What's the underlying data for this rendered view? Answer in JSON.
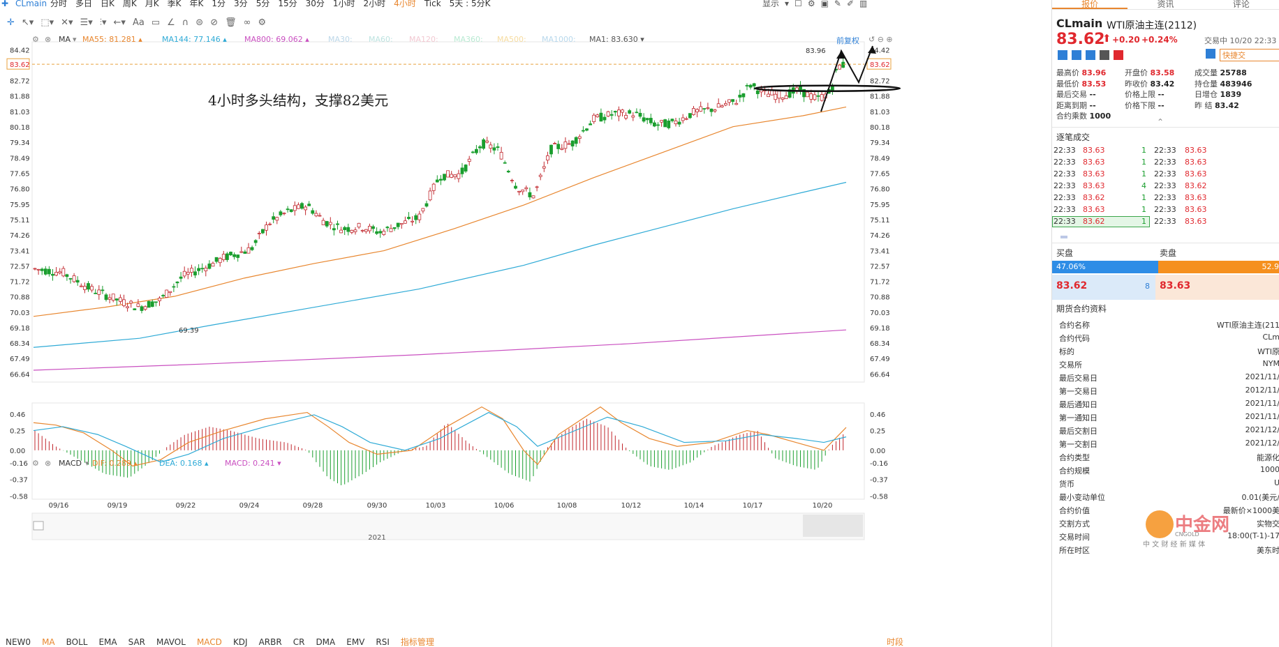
{
  "topbar": {
    "symbol": "CLmain",
    "timeframes": [
      "分时",
      "多日",
      "日K",
      "周K",
      "月K",
      "季K",
      "年K",
      "1分",
      "3分",
      "5分",
      "15分",
      "30分",
      "1小时",
      "2小时",
      "4小时",
      "Tick",
      "5天 : 5分K"
    ],
    "selected": "4小时",
    "right_label": "显示"
  },
  "ma_legend": {
    "label": "MA",
    "items": [
      {
        "text": "MA55: 81.281",
        "color": "#e8862e"
      },
      {
        "text": "MA144: 77.146",
        "color": "#2eaad6"
      },
      {
        "text": "MA800: 69.062",
        "color": "#c94fc0"
      },
      {
        "text": "MA30:",
        "color": "#bcd7e8"
      },
      {
        "text": "MA60:",
        "color": "#bde3e0"
      },
      {
        "text": "MA120:",
        "color": "#f2c9d2"
      },
      {
        "text": "MA360:",
        "color": "#b8ead2"
      },
      {
        "text": "MA500:",
        "color": "#f6dca0"
      },
      {
        "text": "MA1000:",
        "color": "#b8d8ec"
      },
      {
        "text": "MA1: 83.630",
        "color": "#555555"
      }
    ],
    "restore": "前复权"
  },
  "macd_legend": {
    "label": "MACD",
    "items": [
      {
        "text": "DIF: 0.289",
        "color": "#e8862e"
      },
      {
        "text": "DEA: 0.168",
        "color": "#2eaad6"
      },
      {
        "text": "MACD: 0.241",
        "color": "#c94fc0"
      }
    ]
  },
  "annotation": "4小时多头结构，支撑82美元",
  "price_axis": [
    "84.42",
    "83.62",
    "82.72",
    "81.88",
    "81.03",
    "80.18",
    "79.34",
    "78.49",
    "77.65",
    "76.80",
    "75.95",
    "75.11",
    "74.26",
    "73.41",
    "72.57",
    "71.72",
    "70.88",
    "70.03",
    "69.18",
    "68.34",
    "67.49",
    "66.64"
  ],
  "current_price": "83.62",
  "high_label": "83.96",
  "low_label": "69.39",
  "macd_axis": [
    "0.46",
    "0.25",
    "0.00",
    "-0.16",
    "-0.37",
    "-0.58"
  ],
  "date_axis": [
    "09/16",
    "09/19",
    "09/22",
    "09/24",
    "09/28",
    "09/30",
    "10/03",
    "10/06",
    "10/08",
    "10/12",
    "10/14",
    "10/17",
    "10/20"
  ],
  "year_label": "2021",
  "bottom_tabs": [
    "NEW0",
    "MA",
    "BOLL",
    "EMA",
    "SAR",
    "MAVOL",
    "MACD",
    "KDJ",
    "ARBR",
    "CR",
    "DMA",
    "EMV",
    "RSI",
    "指标管理"
  ],
  "bottom_right": "时段",
  "right_panel": {
    "tabs": [
      "报价",
      "资讯",
      "评论"
    ],
    "code": "CLmain",
    "name": "WTI原油主连(2112)",
    "price": "83.62",
    "change": "+0.20",
    "change_pct": "+0.24%",
    "trade_status": "交易中 10/20 22:33",
    "quick_trade": "快捷交",
    "stats": [
      [
        {
          "k": "最高价",
          "v": "83.96",
          "c": "red"
        },
        {
          "k": "开盘价",
          "v": "83.58",
          "c": "red"
        },
        {
          "k": "成交量",
          "v": "25788",
          "c": ""
        }
      ],
      [
        {
          "k": "最低价",
          "v": "83.53",
          "c": "red"
        },
        {
          "k": "昨收价",
          "v": "83.42",
          "c": ""
        },
        {
          "k": "持仓量",
          "v": "483946",
          "c": ""
        }
      ],
      [
        {
          "k": "最后交易",
          "v": "--",
          "c": ""
        },
        {
          "k": "价格上限",
          "v": "--",
          "c": ""
        },
        {
          "k": "日增仓",
          "v": "1839",
          "c": ""
        }
      ],
      [
        {
          "k": "距离到期",
          "v": "--",
          "c": ""
        },
        {
          "k": "价格下限",
          "v": "--",
          "c": ""
        },
        {
          "k": "昨  结",
          "v": "83.42",
          "c": ""
        }
      ],
      [
        {
          "k": "合约乘数",
          "v": "1000",
          "c": ""
        }
      ]
    ],
    "ticks_title": "逐笔成交",
    "ticks": [
      [
        "22:33",
        "83.63",
        "1",
        "22:33",
        "83.63"
      ],
      [
        "22:33",
        "83.63",
        "1",
        "22:33",
        "83.63"
      ],
      [
        "22:33",
        "83.63",
        "1",
        "22:33",
        "83.63"
      ],
      [
        "22:33",
        "83.63",
        "4",
        "22:33",
        "83.62"
      ],
      [
        "22:33",
        "83.62",
        "1",
        "22:33",
        "83.63"
      ],
      [
        "22:33",
        "83.63",
        "1",
        "22:33",
        "83.63"
      ],
      [
        "22:33",
        "83.62",
        "1",
        "22:33",
        "83.63"
      ]
    ],
    "buy_label": "买盘",
    "sell_label": "卖盘",
    "buy_pct": "47.06%",
    "sell_pct": "52.9",
    "buy_pct_value": 47.06,
    "bid_price": "83.62",
    "bid_qty": "8",
    "ask_price": "83.63",
    "contract_title": "期货合约资料",
    "contract": [
      [
        "合约名称",
        "WTI原油主连(211"
      ],
      [
        "合约代码",
        "CLm"
      ],
      [
        "标的",
        "WTI原"
      ],
      [
        "交易所",
        "NYM"
      ],
      [
        "最后交易日",
        "2021/11/"
      ],
      [
        "第一交易日",
        "2012/11/"
      ],
      [
        "最后通知日",
        "2021/11/"
      ],
      [
        "第一通知日",
        "2021/11/"
      ],
      [
        "最后交割日",
        "2021/12/"
      ],
      [
        "第一交割日",
        "2021/12/"
      ],
      [
        "合约类型",
        "能源化"
      ],
      [
        "合约规模",
        "1000"
      ],
      [
        "货币",
        "U"
      ],
      [
        "最小变动单位",
        "0.01(美元/"
      ],
      [
        "合约价值",
        "最新价×1000美"
      ],
      [
        "交割方式",
        "实物交"
      ],
      [
        "交易时间",
        "18:00(T-1)-17"
      ],
      [
        "所在时区",
        "美东时"
      ]
    ],
    "watermark": "中金网",
    "watermark_sub": "中 文 财 经 新 媒 体",
    "watermark_en": "CNGOLD"
  },
  "colors": {
    "up": "#e0282e",
    "down": "#1a9e2e",
    "ma55": "#e8862e",
    "ma144": "#2eaad6",
    "ma800": "#c94fc0",
    "accent": "#e8862e"
  }
}
